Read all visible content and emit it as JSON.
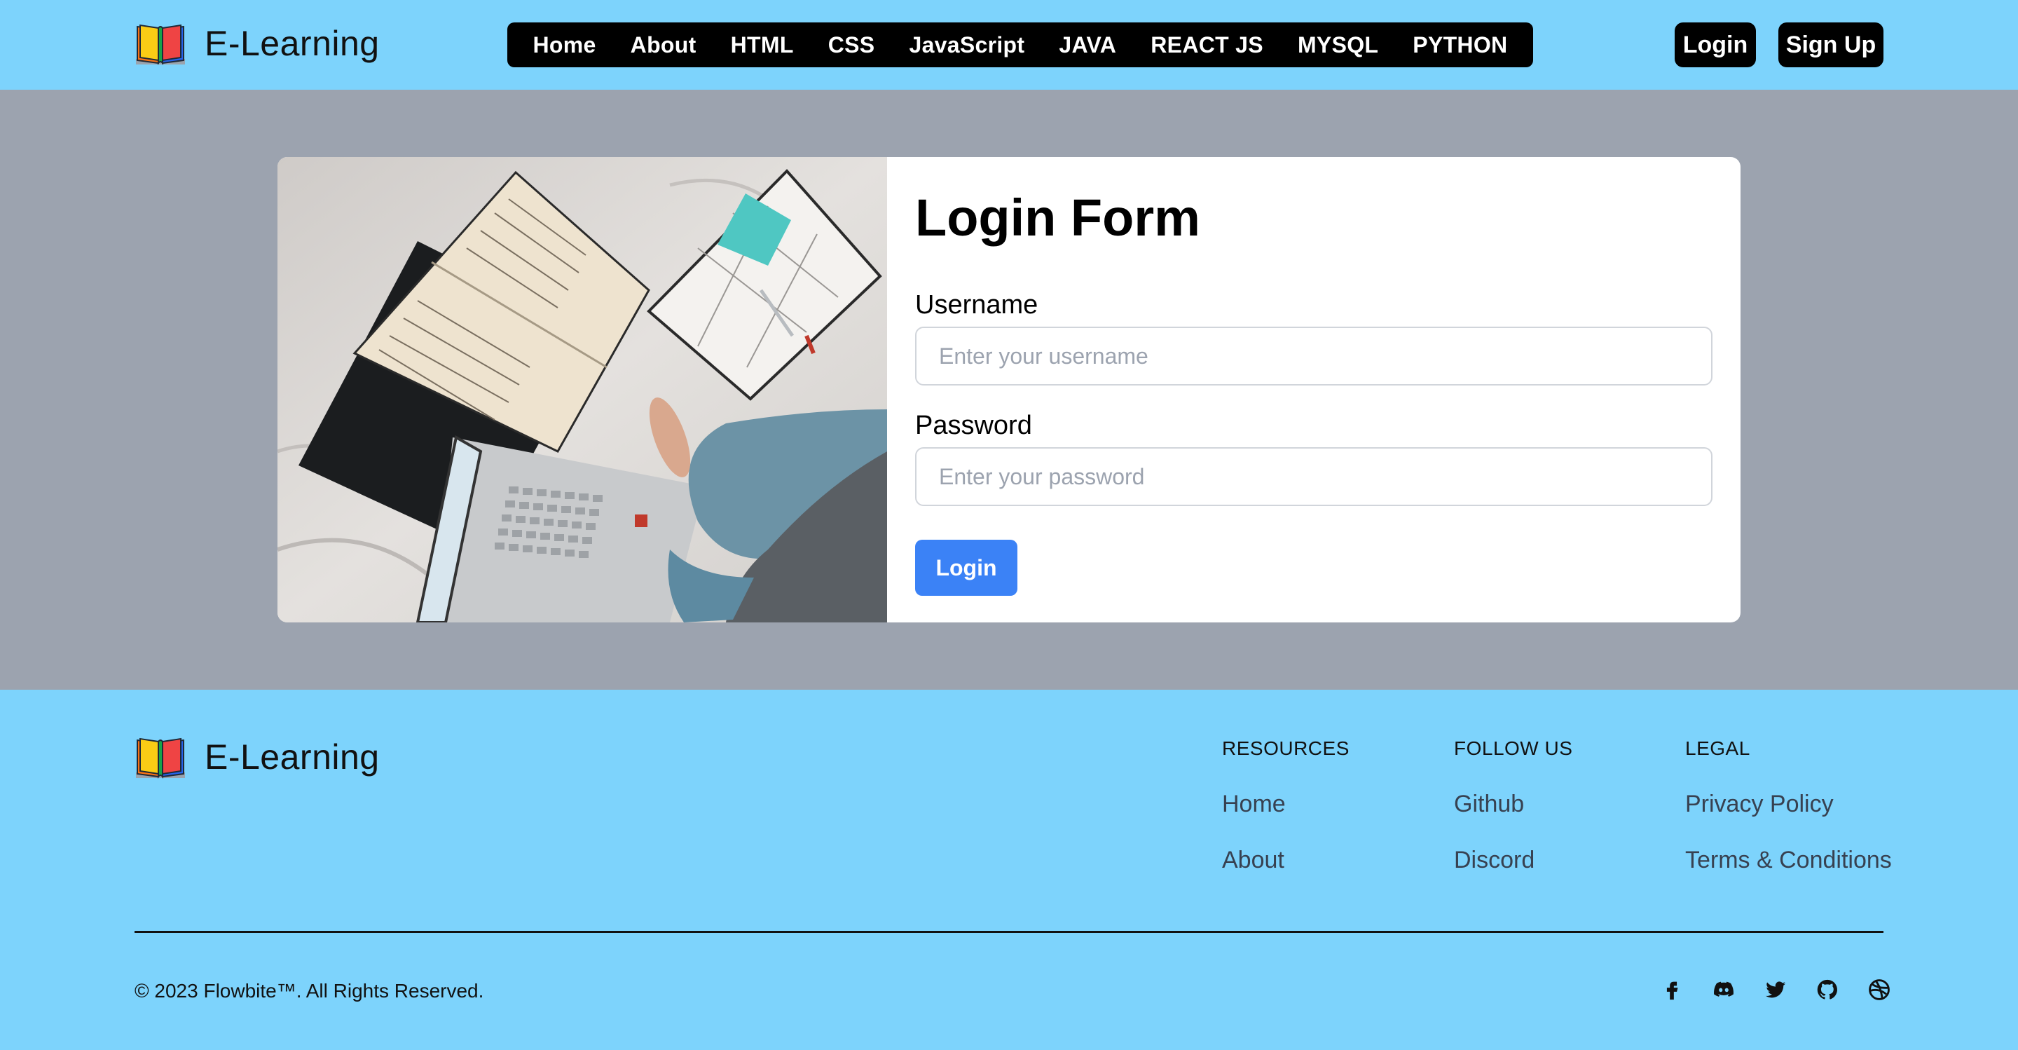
{
  "brand": {
    "name": "E-Learning",
    "icon": "open-book-icon"
  },
  "nav": {
    "items": [
      {
        "label": "Home"
      },
      {
        "label": "About"
      },
      {
        "label": "HTML"
      },
      {
        "label": "CSS"
      },
      {
        "label": "JavaScript"
      },
      {
        "label": "JAVA"
      },
      {
        "label": "REACT JS"
      },
      {
        "label": "MYSQL"
      },
      {
        "label": "PYTHON"
      }
    ]
  },
  "auth": {
    "login_label": "Login",
    "signup_label": "Sign Up"
  },
  "form": {
    "title": "Login Form",
    "username_label": "Username",
    "username_placeholder": "Enter your username",
    "username_value": "",
    "password_label": "Password",
    "password_placeholder": "Enter your password",
    "password_value": "",
    "submit_label": "Login"
  },
  "footer": {
    "columns": [
      {
        "title": "RESOURCES",
        "links": [
          "Home",
          "About"
        ]
      },
      {
        "title": "FOLLOW US",
        "links": [
          "Github",
          "Discord"
        ]
      },
      {
        "title": "LEGAL",
        "links": [
          "Privacy Policy",
          "Terms & Conditions"
        ]
      }
    ],
    "copyright": "© 2023 Flowbite™. All Rights Reserved.",
    "socials": [
      "facebook-icon",
      "discord-icon",
      "twitter-icon",
      "github-icon",
      "dribbble-icon"
    ]
  },
  "colors": {
    "header_bg": "#7dd3fc",
    "main_bg": "#9ca3af",
    "button_blue": "#3b82f6",
    "nav_bg": "#000000"
  }
}
